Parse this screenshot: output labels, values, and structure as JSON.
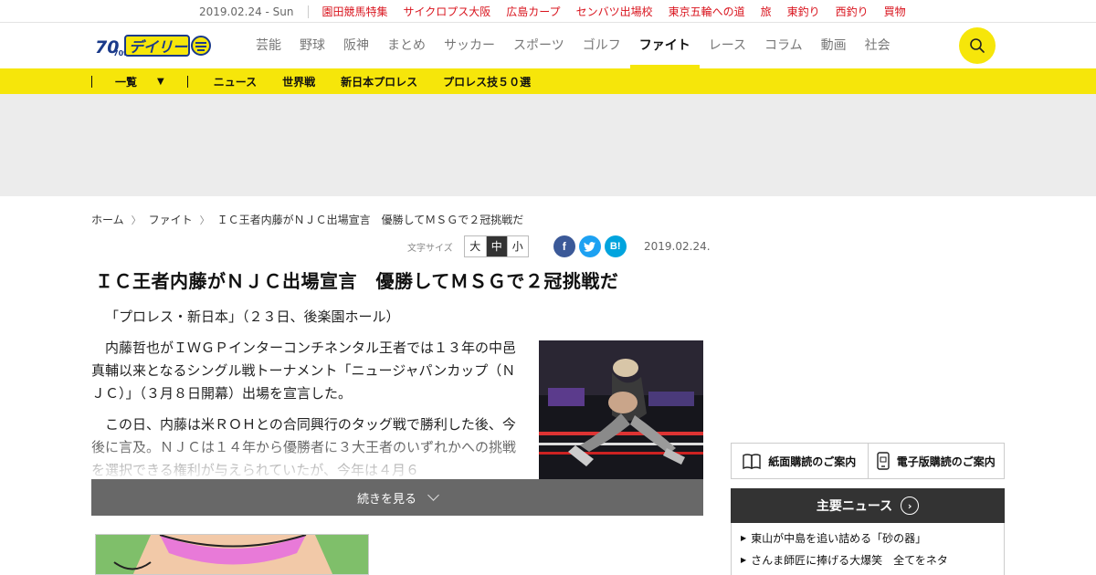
{
  "topbar": {
    "date": "2019.02.24 - Sun",
    "links": [
      "園田競馬特集",
      "サイクロプス大阪",
      "広島カープ",
      "センバツ出場校",
      "東京五輪への道",
      "旅",
      "東釣り",
      "西釣り",
      "買物"
    ]
  },
  "header": {
    "logo_alt": "デイリー",
    "logo_badge": "70th",
    "nav": [
      "芸能",
      "野球",
      "阪神",
      "まとめ",
      "サッカー",
      "スポーツ",
      "ゴルフ",
      "ファイト",
      "レース",
      "コラム",
      "動画",
      "社会"
    ],
    "active_nav": "ファイト",
    "search_icon": "search-icon"
  },
  "subnav": {
    "list_label": "一覧",
    "items": [
      "ニュース",
      "世界戦",
      "新日本プロレス",
      "プロレス技５０選"
    ]
  },
  "breadcrumb": [
    "ホーム",
    "ファイト",
    "ＩＣ王者内藤がＮＪＣ出場宣言　優勝してＭＳＧで２冠挑戦だ"
  ],
  "tools": {
    "font_size_label": "文字サイズ",
    "font_sizes": [
      "大",
      "中",
      "小"
    ],
    "selected_font_size": "中",
    "share": [
      "f",
      "t",
      "B!"
    ],
    "date": "2019.02.24."
  },
  "article": {
    "title": "ＩＣ王者内藤がＮＪＣ出場宣言　優勝してＭＳＧで２冠挑戦だ",
    "lead": "「プロレス・新日本」（２３日、後楽園ホール）",
    "paragraphs": [
      "内藤哲也がＩＷＧＰインターコンチネンタル王者では１３年の中邑真輔以来となるシングル戦トーナメント「ニュージャパンカップ（ＮＪＣ）」（３月８日開幕）出場を宣言した。",
      "この日、内藤は米ＲＯＨとの合同興行のタッグ戦で勝利した後、今後に言及。ＮＪＣは１４年から優勝者に３大王者のいずれかへの挑戦を選択できる権利が与えられていたが、今年は４月６"
    ],
    "more_label": "続きを見る"
  },
  "sidebar": {
    "subscribe": [
      "紙面購読のご案内",
      "電子版購読のご案内"
    ],
    "main_news_title": "主要ニュース",
    "main_news": [
      "東山が中島を追い詰める「砂の器」",
      "さんま師匠に捧げる大爆笑　全てをネタ"
    ]
  },
  "colors": {
    "brand_yellow": "#f6e60a",
    "topbar_link_red": "#d9141e",
    "dark": "#333333"
  }
}
